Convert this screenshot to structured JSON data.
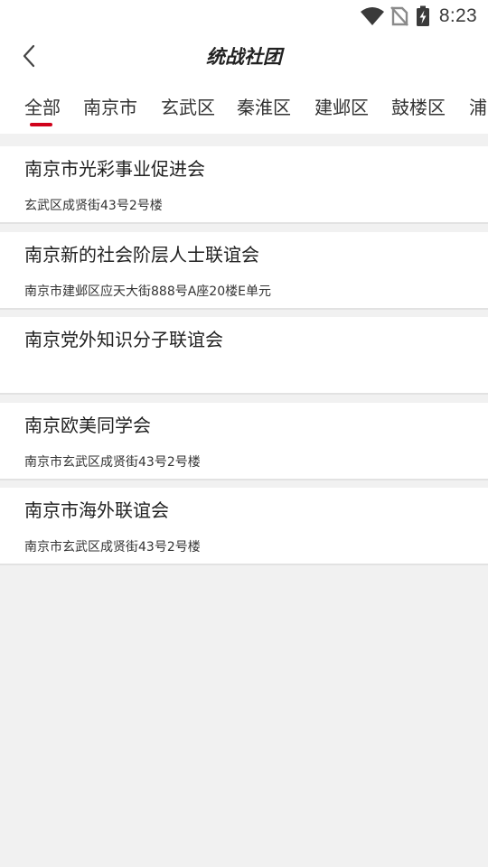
{
  "status_bar": {
    "time": "8:23",
    "icons": [
      "wifi-icon",
      "no-sim-icon",
      "battery-charging-icon"
    ]
  },
  "header": {
    "title": "统战社团",
    "back_icon": "chevron-left-icon"
  },
  "tabs": [
    {
      "label": "全部",
      "active": true
    },
    {
      "label": "南京市",
      "active": false
    },
    {
      "label": "玄武区",
      "active": false
    },
    {
      "label": "秦淮区",
      "active": false
    },
    {
      "label": "建邺区",
      "active": false
    },
    {
      "label": "鼓楼区",
      "active": false
    },
    {
      "label": "浦",
      "active": false
    }
  ],
  "colors": {
    "accent": "#d0021b",
    "background": "#f1f1f1",
    "card": "#ffffff"
  },
  "organizations": [
    {
      "name": "南京市光彩事业促进会",
      "address": "玄武区成贤街43号2号楼"
    },
    {
      "name": "南京新的社会阶层人士联谊会",
      "address": "南京市建邺区应天大街888号A座20楼E单元"
    },
    {
      "name": "南京党外知识分子联谊会",
      "address": ""
    },
    {
      "name": "南京欧美同学会",
      "address": "南京市玄武区成贤街43号2号楼"
    },
    {
      "name": "南京市海外联谊会",
      "address": "南京市玄武区成贤街43号2号楼"
    }
  ]
}
